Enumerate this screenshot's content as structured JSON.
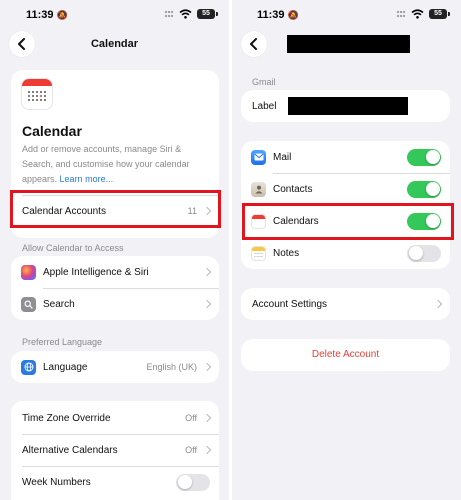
{
  "left": {
    "status": {
      "time": "11:39",
      "battery": "55"
    },
    "nav": {
      "title": "Calendar"
    },
    "intro": {
      "title": "Calendar",
      "description": "Add or remove accounts, manage Siri & Search, and customise how your calendar appears.",
      "learn_more": "Learn more..."
    },
    "accounts_row": {
      "label": "Calendar Accounts",
      "value": "11"
    },
    "access_header": "Allow Calendar to Access",
    "access_items": [
      {
        "label": "Apple Intelligence & Siri",
        "icon": "apple-intelligence-icon"
      },
      {
        "label": "Search",
        "icon": "search-icon"
      }
    ],
    "language_header": "Preferred Language",
    "language_row": {
      "label": "Language",
      "value": "English (UK)",
      "icon": "globe-icon"
    },
    "settings_rows": [
      {
        "label": "Time Zone Override",
        "value": "Off"
      },
      {
        "label": "Alternative Calendars",
        "value": "Off"
      },
      {
        "label": "Week Numbers",
        "toggle": false
      }
    ]
  },
  "right": {
    "status": {
      "time": "11:39",
      "battery": "55"
    },
    "account_header": "Gmail",
    "label_row": {
      "label": "Label"
    },
    "services": [
      {
        "label": "Mail",
        "icon": "mail-icon",
        "enabled": true
      },
      {
        "label": "Contacts",
        "icon": "contacts-icon",
        "enabled": true
      },
      {
        "label": "Calendars",
        "icon": "calendar-icon",
        "enabled": true
      },
      {
        "label": "Notes",
        "icon": "notes-icon",
        "enabled": false
      }
    ],
    "account_settings": "Account Settings",
    "delete_account": "Delete Account"
  },
  "colors": {
    "highlight": "#e2141e",
    "toggle_on": "#34c759",
    "link": "#2a7ae2",
    "destructive": "#e5403b"
  }
}
